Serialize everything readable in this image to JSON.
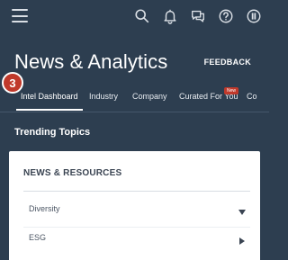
{
  "header": {
    "icons": [
      "hamburger-icon",
      "search-icon",
      "bell-icon",
      "chat-icon",
      "help-icon",
      "info-icon"
    ]
  },
  "page": {
    "title": "News & Analytics",
    "feedback_label": "FEEDBACK"
  },
  "tabs": [
    {
      "label": "Intel Dashboard",
      "active": true
    },
    {
      "label": "Industry",
      "active": false
    },
    {
      "label": "Company",
      "active": false
    },
    {
      "label": "Curated For You",
      "active": false,
      "badge": "New"
    },
    {
      "label": "Co",
      "active": false
    }
  ],
  "step_badge": "3",
  "trending": {
    "heading": "Trending Topics"
  },
  "news_card": {
    "title": "NEWS & RESOURCES",
    "rows": [
      {
        "label": "Diversity",
        "arrow": "caret-down-icon"
      },
      {
        "label": "ESG",
        "arrow": "caret-right-icon"
      }
    ]
  },
  "colors": {
    "background": "#2d3e50",
    "accent_red": "#c0392b",
    "card_bg": "#ffffff"
  }
}
